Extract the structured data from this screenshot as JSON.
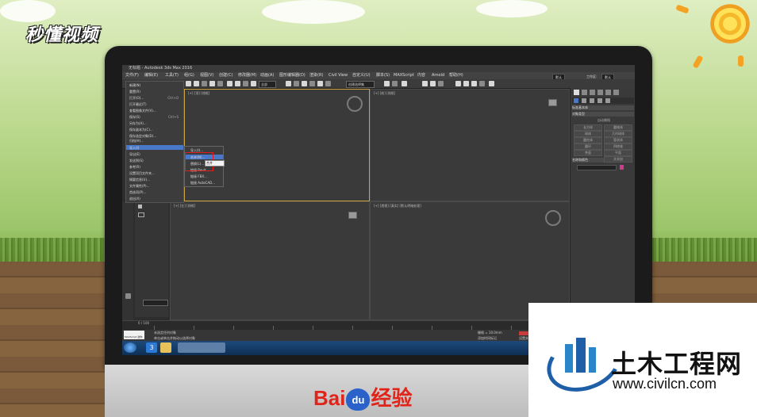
{
  "brand_top": "秒懂视频",
  "app": {
    "title": "无标题 - Autodesk 3ds Max 2016",
    "menu": [
      "文件(F)",
      "编辑(E)",
      "工具(T)",
      "组(G)",
      "视图(V)",
      "创建(C)",
      "修改器(M)",
      "动画(A)",
      "图形编辑器(D)",
      "渲染(R)",
      "Civil View",
      "自定义(U)",
      "脚本(S)",
      "MAXScript",
      "内容",
      "Arnold",
      "帮助(H)"
    ],
    "workspace_label": "工作区:",
    "workspace_value": "默认",
    "toolbar_dropdown": "全部",
    "selection_set": "创建选择集"
  },
  "file_menu": {
    "items": [
      {
        "label": "新建(N)",
        "shortcut": ""
      },
      {
        "label": "重置(R)",
        "shortcut": ""
      },
      {
        "label": "打开(O)...",
        "shortcut": "Ctrl+O"
      },
      {
        "label": "打开最近(T)",
        "shortcut": ""
      },
      {
        "label": "查看图像文件(V)...",
        "shortcut": ""
      },
      {
        "label": "保存(S)",
        "shortcut": "Ctrl+S"
      },
      {
        "label": "另存为(A)...",
        "shortcut": ""
      },
      {
        "label": "保存副本为(C)...",
        "shortcut": ""
      },
      {
        "label": "保存选定对象(D)...",
        "shortcut": ""
      },
      {
        "label": "归档(H)...",
        "shortcut": ""
      },
      {
        "label": "导入(I)",
        "shortcut": ""
      },
      {
        "label": "导出(E)",
        "shortcut": ""
      },
      {
        "label": "发送到(S)",
        "shortcut": ""
      },
      {
        "label": "参考(R)",
        "shortcut": ""
      },
      {
        "label": "设置项目文件夹...",
        "shortcut": ""
      },
      {
        "label": "摘要信息(U)...",
        "shortcut": ""
      },
      {
        "label": "文件属性(P)...",
        "shortcut": ""
      },
      {
        "label": "首选项(P)...",
        "shortcut": ""
      },
      {
        "label": "退出(X)",
        "shortcut": ""
      }
    ],
    "highlighted": "导入(I)"
  },
  "import_submenu": {
    "items": [
      "导入(I)...",
      "合并(M)...",
      "替换(L)...",
      "链接 Revit...",
      "链接 FBX...",
      "链接 AutoCAD..."
    ],
    "highlighted": "合并(M)...",
    "tooltip": "合并"
  },
  "viewports": {
    "top": "[+] [顶] [线框]",
    "front": "[+] [前] [线框]",
    "left": "[+] [左] [线框]",
    "perspective": "[+] [透视] [真实] [默认明暗处理]"
  },
  "command_panel": {
    "rollout1": "标准基本体",
    "rollout1_header": "对象类型",
    "auto_grid": "自动栅格",
    "objects": [
      "长方体",
      "圆锥体",
      "球体",
      "几何球体",
      "圆柱体",
      "管状体",
      "圆环",
      "四棱锥",
      "茶壶",
      "平面",
      "文本加"
    ],
    "rollout2": "名称和颜色"
  },
  "status": {
    "line1": "未选定任何对象",
    "line2": "单击或单击并拖动以选择对象",
    "script_label": "MAXScript 迷你",
    "frames": "0 / 100",
    "grid": "栅格 = 10.0mm",
    "add_time_tag": "添加时间标记",
    "auto_key": "自动关键点",
    "set_key": "设置关键点"
  },
  "taskbar": {
    "badge": "3"
  },
  "baidu": {
    "text_left": "Bai",
    "paw": "du",
    "text_right": "经验"
  },
  "watermark": {
    "title": "土木工程网",
    "url": "www.civilcn.com"
  }
}
